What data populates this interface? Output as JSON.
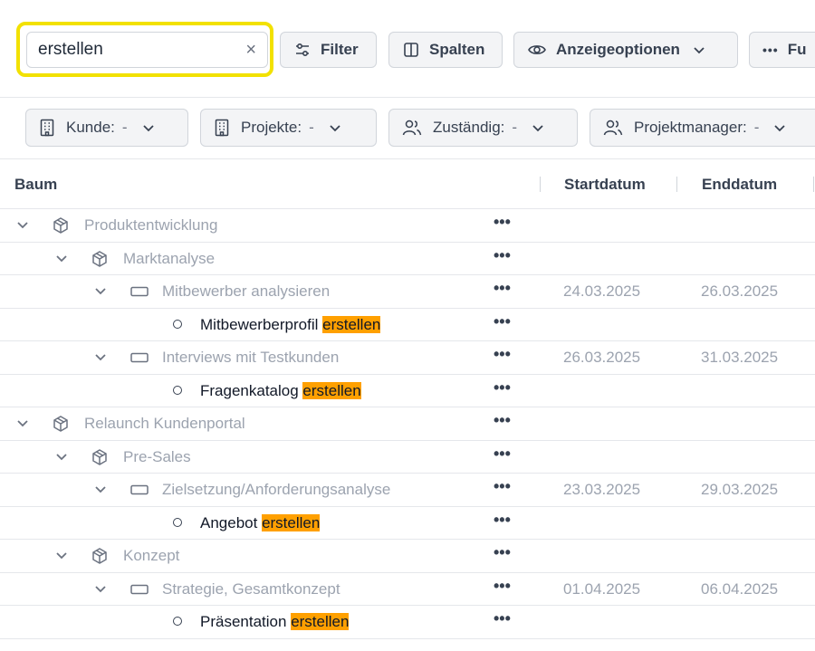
{
  "search": {
    "value": "erstellen",
    "clear_label": "×"
  },
  "toolbar": {
    "filter_label": "Filter",
    "spalten_label": "Spalten",
    "anzeige_label": "Anzeigeoptionen",
    "more_label": "Fu"
  },
  "filters": [
    {
      "label": "Kunde:",
      "value": "-"
    },
    {
      "label": "Projekte:",
      "value": "-"
    },
    {
      "label": "Zuständig:",
      "value": "-"
    },
    {
      "label": "Projektmanager:",
      "value": "-"
    }
  ],
  "table": {
    "headers": {
      "tree": "Baum",
      "start": "Startdatum",
      "end": "Enddatum"
    },
    "more_glyph": "•••",
    "highlight_color": "#ffa000",
    "rows": [
      {
        "level": 0,
        "type": "project",
        "label": "Produktentwicklung",
        "match": "",
        "start": "",
        "end": ""
      },
      {
        "level": 1,
        "type": "project",
        "label": "Marktanalyse",
        "match": "",
        "start": "",
        "end": ""
      },
      {
        "level": 2,
        "type": "task",
        "label": "Mitbewerber analysieren",
        "match": "",
        "start": "24.03.2025",
        "end": "26.03.2025"
      },
      {
        "level": 3,
        "type": "item",
        "label": "Mitbewerberprofil ",
        "match": "erstellen",
        "start": "",
        "end": ""
      },
      {
        "level": 2,
        "type": "task",
        "label": "Interviews mit Testkunden",
        "match": "",
        "start": "26.03.2025",
        "end": "31.03.2025"
      },
      {
        "level": 3,
        "type": "item",
        "label": "Fragenkatalog ",
        "match": "erstellen",
        "start": "",
        "end": ""
      },
      {
        "level": 0,
        "type": "project",
        "label": "Relaunch Kundenportal",
        "match": "",
        "start": "",
        "end": ""
      },
      {
        "level": 1,
        "type": "project",
        "label": "Pre-Sales",
        "match": "",
        "start": "",
        "end": ""
      },
      {
        "level": 2,
        "type": "task",
        "label": "Zielsetzung/Anforderungsanalyse",
        "match": "",
        "start": "23.03.2025",
        "end": "29.03.2025"
      },
      {
        "level": 3,
        "type": "item",
        "label": "Angebot ",
        "match": "erstellen",
        "start": "",
        "end": ""
      },
      {
        "level": 1,
        "type": "project",
        "label": "Konzept",
        "match": "",
        "start": "",
        "end": ""
      },
      {
        "level": 2,
        "type": "task",
        "label": "Strategie, Gesamtkonzept",
        "match": "",
        "start": "01.04.2025",
        "end": "06.04.2025"
      },
      {
        "level": 3,
        "type": "item",
        "label": "Präsentation ",
        "match": "erstellen",
        "start": "",
        "end": ""
      }
    ]
  }
}
